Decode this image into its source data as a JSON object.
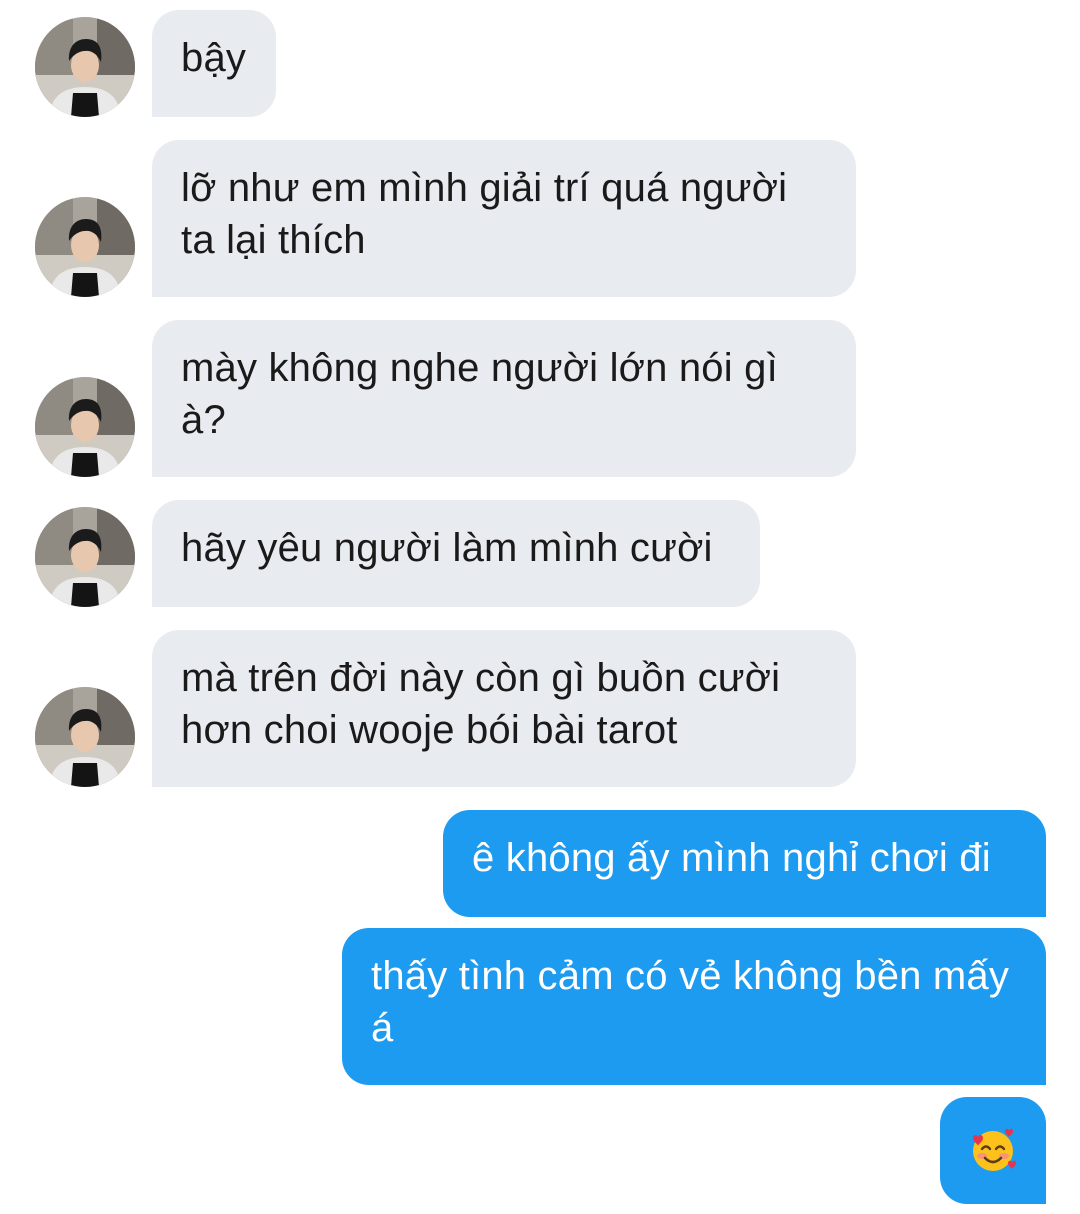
{
  "conversation": {
    "messages": [
      {
        "sender": "them",
        "text": "bậy"
      },
      {
        "sender": "them",
        "text": "lỡ như em mình giải trí quá người ta lại thích"
      },
      {
        "sender": "them",
        "text": "mày không nghe người lớn nói gì à?"
      },
      {
        "sender": "them",
        "text": "hãy yêu người làm mình cười"
      },
      {
        "sender": "them",
        "text": "mà trên đời này còn gì buồn cười hơn choi wooje bói bài tarot"
      },
      {
        "sender": "me",
        "text": "ê không ấy mình nghỉ chơi đi"
      },
      {
        "sender": "me",
        "text": "thấy tình cảm có vẻ không bền mấy á"
      },
      {
        "sender": "me",
        "emoji": "smiling-face-with-hearts"
      }
    ]
  },
  "colors": {
    "incoming_bubble": "#e8ebef",
    "outgoing_bubble": "#1d9bf0",
    "incoming_text": "#1a1a1a",
    "outgoing_text": "#ffffff"
  }
}
